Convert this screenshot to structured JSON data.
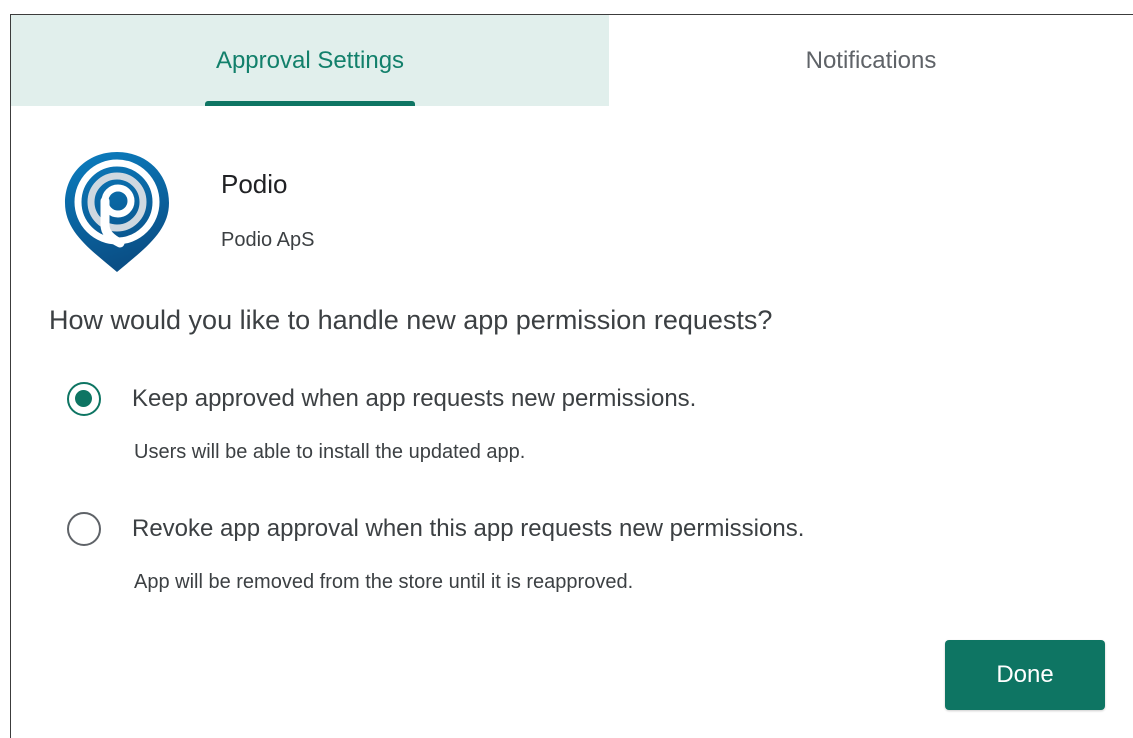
{
  "tabs": {
    "approval_settings": "Approval Settings",
    "notifications": "Notifications",
    "active": "approval_settings"
  },
  "app": {
    "name": "Podio",
    "vendor": "Podio ApS",
    "icon": "podio-logo-icon"
  },
  "settings": {
    "question": "How would you like to handle new app permission requests?",
    "options": [
      {
        "label": "Keep approved when app requests new permissions.",
        "description": "Users will be able to install the updated app.",
        "selected": true
      },
      {
        "label": "Revoke app approval when this app requests new permissions.",
        "description": "App will be removed from the store until it is reapproved.",
        "selected": false
      }
    ]
  },
  "actions": {
    "done_label": "Done"
  },
  "colors": {
    "accent": "#0e7563",
    "active_tab_bg": "#e1efec",
    "active_tab_text": "#12806b"
  }
}
